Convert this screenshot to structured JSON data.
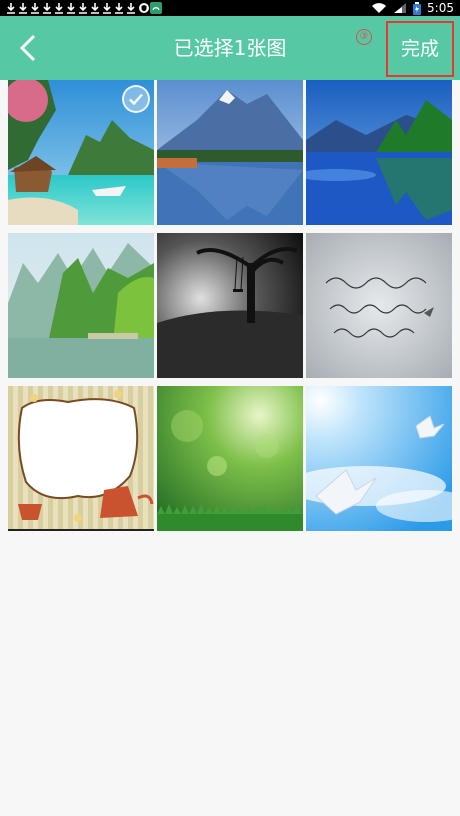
{
  "status_bar": {
    "time": "5:05"
  },
  "app_bar": {
    "title": "已选择1张图",
    "step_marker": "③",
    "done_label": "完成"
  },
  "gallery": {
    "items": [
      {
        "subject": "tropical-beach-hut",
        "selected": true
      },
      {
        "subject": "mountain-lake-reflection",
        "selected": false
      },
      {
        "subject": "blue-lake-forest",
        "selected": false
      },
      {
        "subject": "karst-river-landscape",
        "selected": false
      },
      {
        "subject": "tree-swing-dark",
        "selected": false
      },
      {
        "subject": "handwritten-note",
        "selected": false
      },
      {
        "subject": "cartoon-frame-teapot",
        "selected": false
      },
      {
        "subject": "green-bokeh",
        "selected": false
      },
      {
        "subject": "paper-cranes-sky",
        "selected": false
      }
    ]
  },
  "colors": {
    "accent": "#56c8a3",
    "highlight": "#e53935",
    "background": "#f7f7f7"
  }
}
